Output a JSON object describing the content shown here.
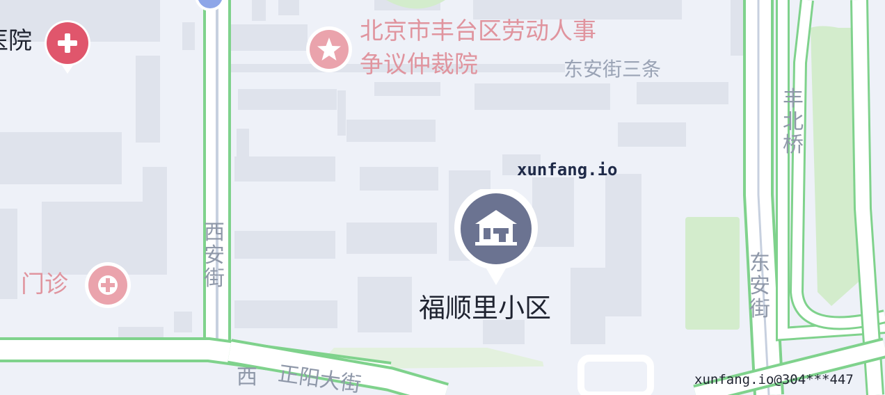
{
  "map": {
    "colors": {
      "background": "#eef1f8",
      "building": "#dfe3ec",
      "road": "#ffffff",
      "road_edge": "#7fd28c",
      "green_area": "#d3eccc",
      "poi_label": "#e07a86",
      "road_label": "#9aa3b5",
      "primary_pin": "#6b7391",
      "hospital_pin": "#e0566c"
    },
    "pois": {
      "primary": {
        "label": "福顺里小区",
        "icon": "house-icon"
      },
      "hospital": {
        "label": "医院",
        "label_visible": "医院",
        "icon": "medical-cross-icon"
      },
      "arbitration": {
        "label_line1": "北京市丰台区劳动人事",
        "label_line2": "争议仲裁院",
        "icon": "star-icon"
      },
      "clinic": {
        "label": "门诊",
        "icon": "medical-cross-icon"
      }
    },
    "roads": {
      "dongan_3": "东安街三条",
      "xian": [
        "西",
        "安",
        "街"
      ],
      "fengbei": [
        "丰",
        "北",
        "桥"
      ],
      "dongan": [
        "东",
        "安",
        "街"
      ],
      "zhengyang": "正阳大街",
      "xi_bottom": "西"
    },
    "watermark": {
      "center": "xunfang.io",
      "corner": "xunfang.io@304***447"
    }
  }
}
